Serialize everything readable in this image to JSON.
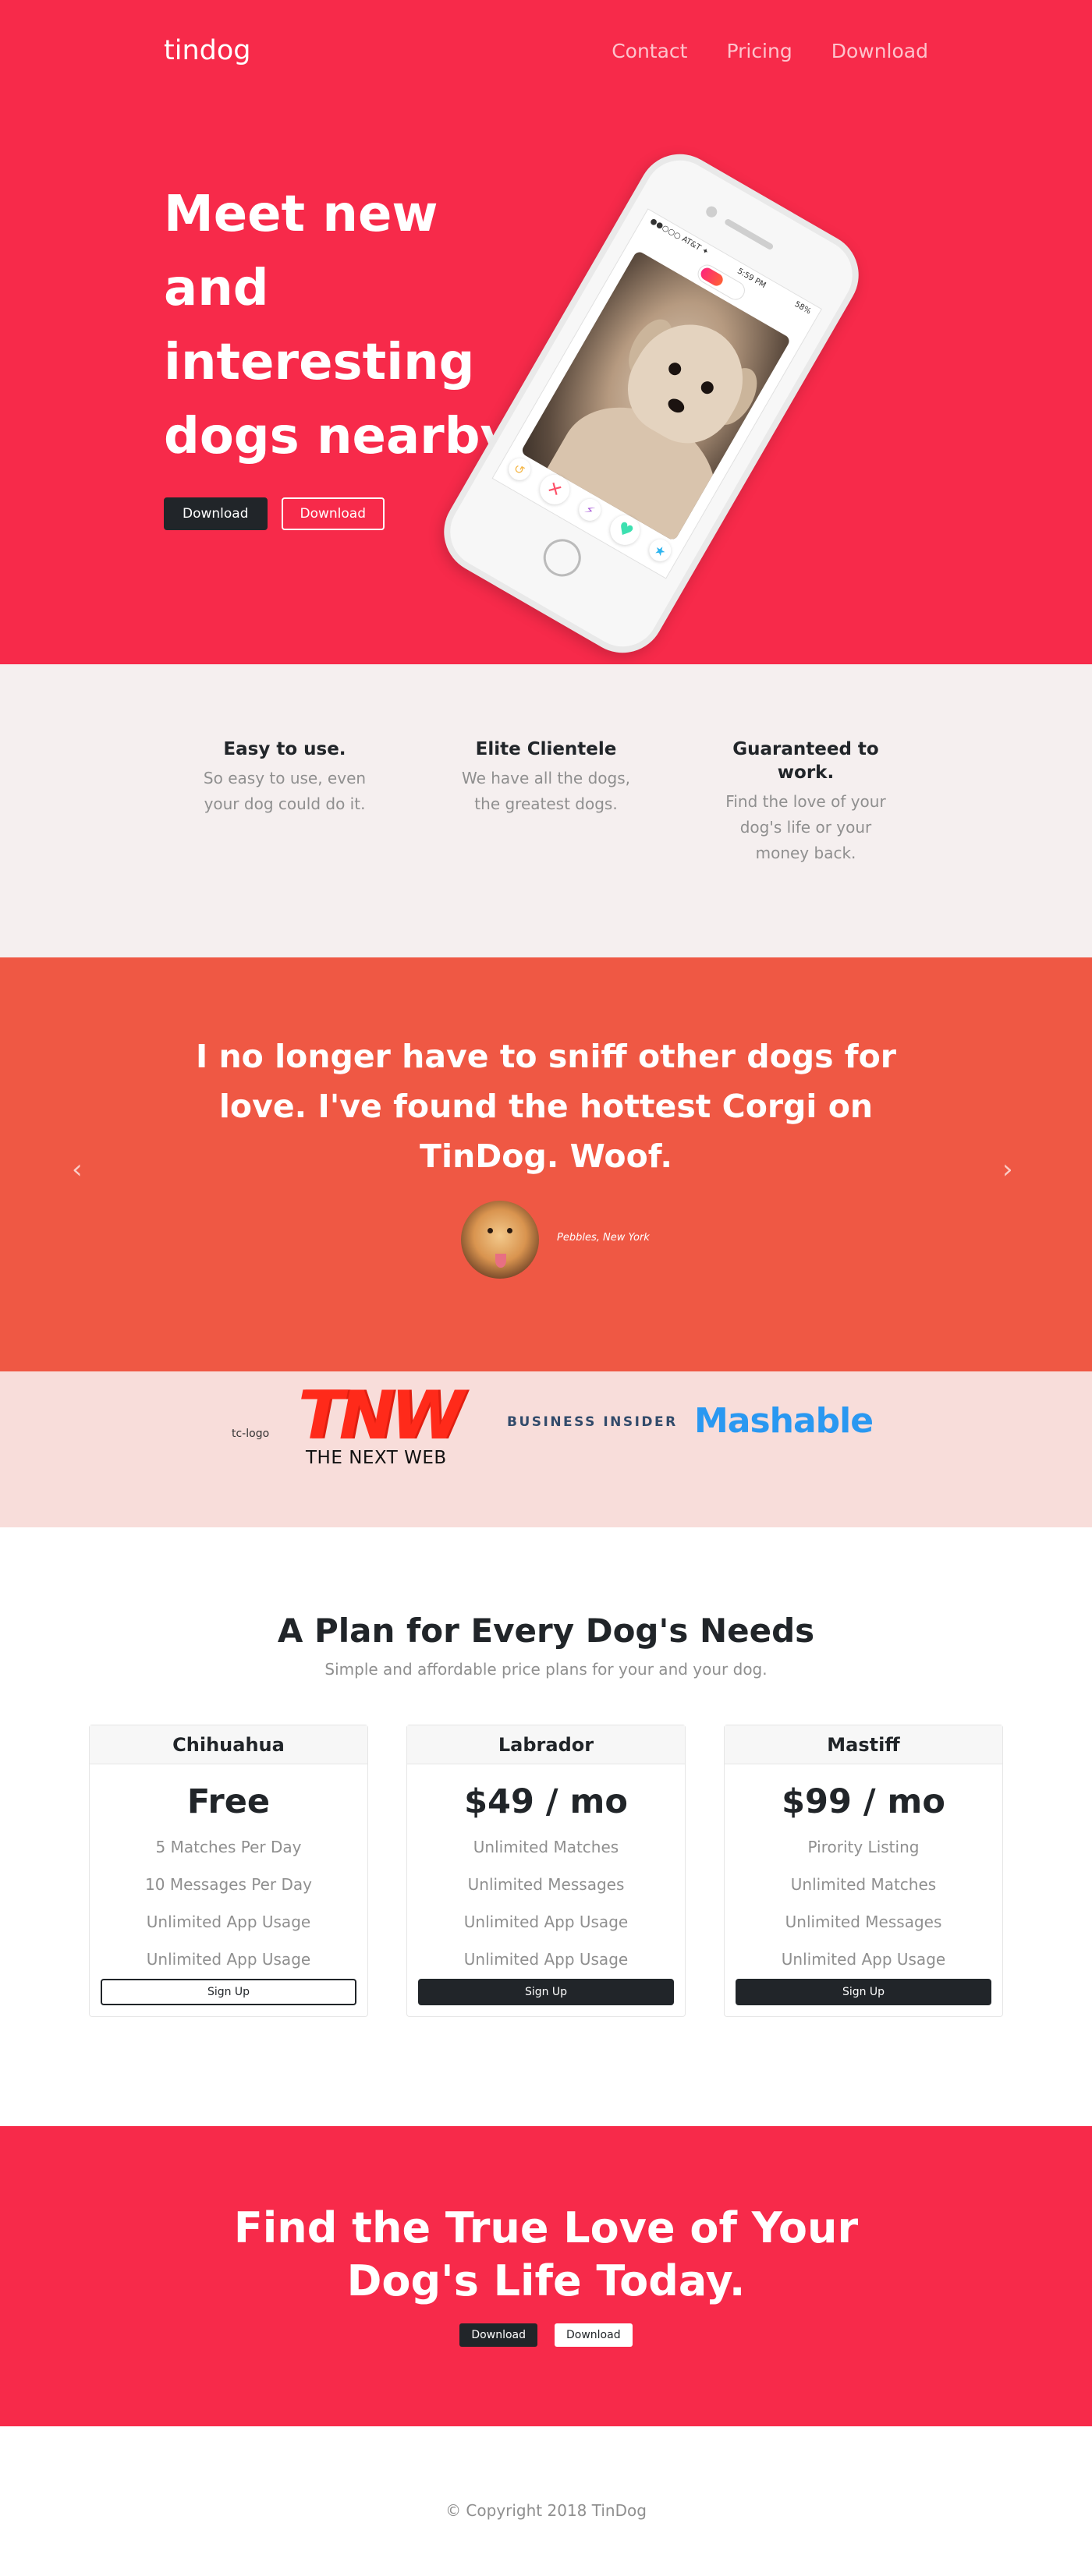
{
  "nav": {
    "brand": "tindog",
    "links": [
      "Contact",
      "Pricing",
      "Download"
    ]
  },
  "hero": {
    "title": "Meet new and interesting dogs nearby.",
    "buttons": [
      "Download",
      "Download"
    ],
    "phone": {
      "carrier": "●●○○○ AT&T ✦",
      "time": "5:59 PM",
      "battery": "58%"
    }
  },
  "features": [
    {
      "title": "Easy to use.",
      "text": "So easy to use, even your dog could do it."
    },
    {
      "title": "Elite Clientele",
      "text": "We have all the dogs, the greatest dogs."
    },
    {
      "title": "Guaranteed to work.",
      "text": "Find the love of your dog's life or your money back."
    }
  ],
  "testimonial": {
    "quote": "I no longer have to sniff other dogs for love. I've found the hottest Corgi on TinDog. Woof.",
    "author": "Pebbles, New York",
    "prev": "‹",
    "next": "›"
  },
  "press": {
    "tc_logo": "tc-logo",
    "tnw_mark": "TNW",
    "tnw_text": "THE NEXT WEB",
    "business_insider": "BUSINESS INSIDER",
    "mashable": "Mashable"
  },
  "pricing": {
    "title": "A Plan for Every Dog's Needs",
    "subtitle": "Simple and affordable price plans for your and your dog.",
    "plans": [
      {
        "name": "Chihuahua",
        "price": "Free",
        "features": [
          "5 Matches Per Day",
          "10 Messages Per Day",
          "Unlimited App Usage",
          "Unlimited App Usage"
        ],
        "button": "Sign Up"
      },
      {
        "name": "Labrador",
        "price": "$49 / mo",
        "features": [
          "Unlimited Matches",
          "Unlimited Messages",
          "Unlimited App Usage",
          "Unlimited App Usage"
        ],
        "button": "Sign Up"
      },
      {
        "name": "Mastiff",
        "price": "$99 / mo",
        "features": [
          "Pirority Listing",
          "Unlimited Matches",
          "Unlimited Messages",
          "Unlimited App Usage"
        ],
        "button": "Sign Up"
      }
    ]
  },
  "cta": {
    "title": "Find the True Love of Your Dog's Life Today.",
    "buttons": [
      "Download",
      "Download"
    ]
  },
  "footer": {
    "copyright": "© Copyright 2018 TinDog"
  },
  "colors": {
    "primary_red": "#f72a4a",
    "testimonial_orange": "#ef5844",
    "press_pink": "#f8ddda",
    "features_bg": "#f5efef",
    "dark": "#212529"
  }
}
